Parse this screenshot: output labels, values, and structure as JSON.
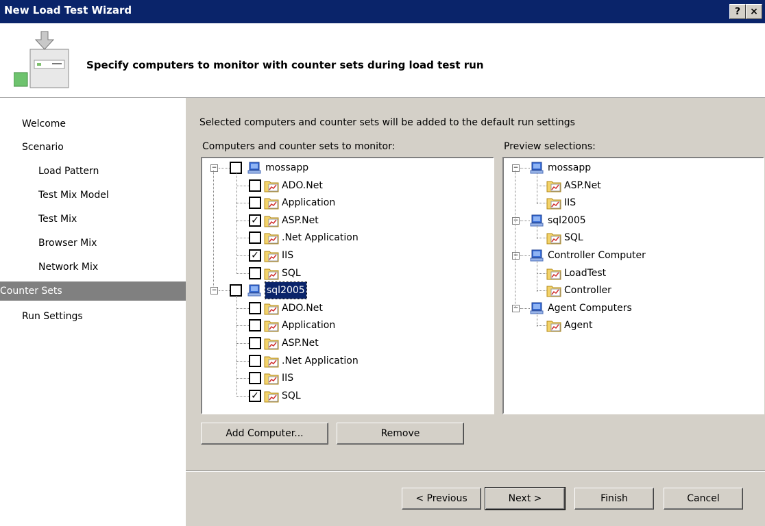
{
  "window": {
    "title": "New Load Test Wizard",
    "help_label": "?",
    "close_label": "×"
  },
  "header": {
    "heading": "Specify computers to monitor with counter sets during load test run"
  },
  "nav": {
    "items": [
      {
        "label": "Welcome"
      },
      {
        "label": "Scenario"
      },
      {
        "label": "Load Pattern"
      },
      {
        "label": "Test Mix Model"
      },
      {
        "label": "Test Mix"
      },
      {
        "label": "Browser Mix"
      },
      {
        "label": "Network Mix"
      },
      {
        "label": "Counter Sets"
      },
      {
        "label": "Run Settings"
      }
    ]
  },
  "content": {
    "description": "Selected computers and counter sets will be added to the default run settings",
    "left_label": "Computers and counter sets to monitor:",
    "right_label": "Preview selections:"
  },
  "left_tree": {
    "computers": [
      {
        "name": "mossapp",
        "counters": [
          {
            "name": "ADO.Net",
            "checked": false
          },
          {
            "name": "Application",
            "checked": false
          },
          {
            "name": "ASP.Net",
            "checked": true
          },
          {
            "name": ".Net Application",
            "checked": false
          },
          {
            "name": "IIS",
            "checked": true
          },
          {
            "name": "SQL",
            "checked": false
          }
        ]
      },
      {
        "name": "sql2005",
        "counters": [
          {
            "name": "ADO.Net",
            "checked": false
          },
          {
            "name": "Application",
            "checked": false
          },
          {
            "name": "ASP.Net",
            "checked": false
          },
          {
            "name": ".Net Application",
            "checked": false
          },
          {
            "name": "IIS",
            "checked": false
          },
          {
            "name": "SQL",
            "checked": true
          }
        ]
      }
    ]
  },
  "right_tree": {
    "computers": [
      {
        "name": "mossapp",
        "counters": [
          "ASP.Net",
          "IIS"
        ]
      },
      {
        "name": "sql2005",
        "counters": [
          "SQL"
        ]
      },
      {
        "name": "Controller Computer",
        "counters": [
          "LoadTest",
          "Controller"
        ]
      },
      {
        "name": "Agent Computers",
        "counters": [
          "Agent"
        ]
      }
    ]
  },
  "buttons": {
    "add_computer": "Add Computer...",
    "remove": "Remove",
    "previous": "< Previous",
    "next": "Next >",
    "finish": "Finish",
    "cancel": "Cancel"
  }
}
